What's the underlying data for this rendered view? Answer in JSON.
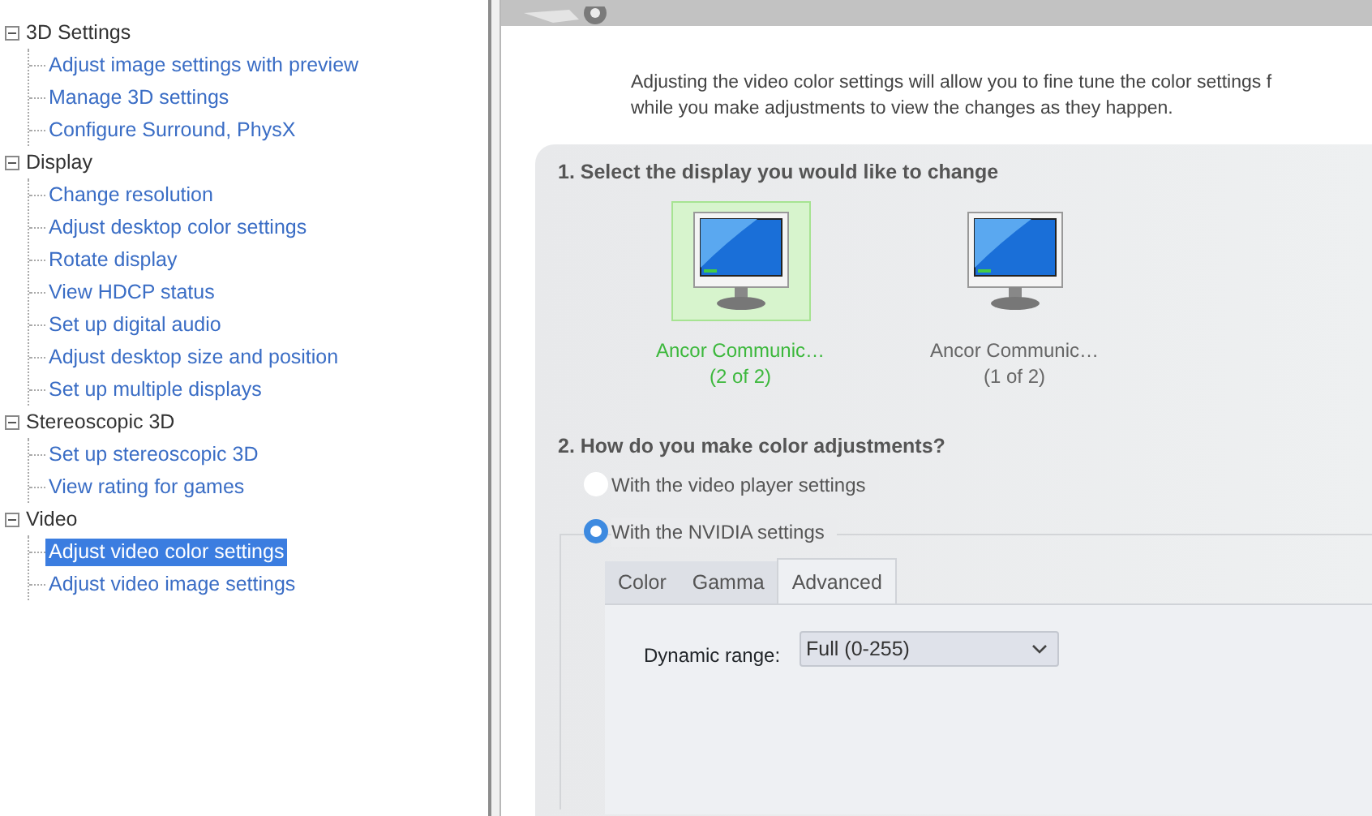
{
  "tree": [
    {
      "label": "3D Settings",
      "expanded": true,
      "children": [
        {
          "label": "Adjust image settings with preview",
          "selected": false
        },
        {
          "label": "Manage 3D settings",
          "selected": false
        },
        {
          "label": "Configure Surround, PhysX",
          "selected": false
        }
      ]
    },
    {
      "label": "Display",
      "expanded": true,
      "children": [
        {
          "label": "Change resolution",
          "selected": false
        },
        {
          "label": "Adjust desktop color settings",
          "selected": false
        },
        {
          "label": "Rotate display",
          "selected": false
        },
        {
          "label": "View HDCP status",
          "selected": false
        },
        {
          "label": "Set up digital audio",
          "selected": false
        },
        {
          "label": "Adjust desktop size and position",
          "selected": false
        },
        {
          "label": "Set up multiple displays",
          "selected": false
        }
      ]
    },
    {
      "label": "Stereoscopic 3D",
      "expanded": true,
      "children": [
        {
          "label": "Set up stereoscopic 3D",
          "selected": false
        },
        {
          "label": "View rating for games",
          "selected": false
        }
      ]
    },
    {
      "label": "Video",
      "expanded": true,
      "children": [
        {
          "label": "Adjust video color settings",
          "selected": true
        },
        {
          "label": "Adjust video image settings",
          "selected": false
        }
      ]
    }
  ],
  "description": [
    "Adjusting the video color settings will allow you to fine tune the color settings f",
    "while you make adjustments to view the changes as they happen."
  ],
  "section_1": {
    "heading": "1. Select the display you would like to change",
    "displays": [
      {
        "name": "Ancor Communic…",
        "index": "(2 of 2)",
        "selected": true
      },
      {
        "name": "Ancor Communic…",
        "index": "(1 of 2)",
        "selected": false
      }
    ]
  },
  "section_2": {
    "heading": "2. How do you make color adjustments?",
    "options": [
      {
        "label": "With the video player settings",
        "selected": false
      },
      {
        "label": "With the NVIDIA settings",
        "selected": true
      }
    ],
    "tabs": [
      {
        "label": "Color",
        "selected": false
      },
      {
        "label": "Gamma",
        "selected": false
      },
      {
        "label": "Advanced",
        "selected": true
      }
    ],
    "dynamic_range": {
      "label": "Dynamic range:",
      "value": "Full (0-255)"
    }
  }
}
